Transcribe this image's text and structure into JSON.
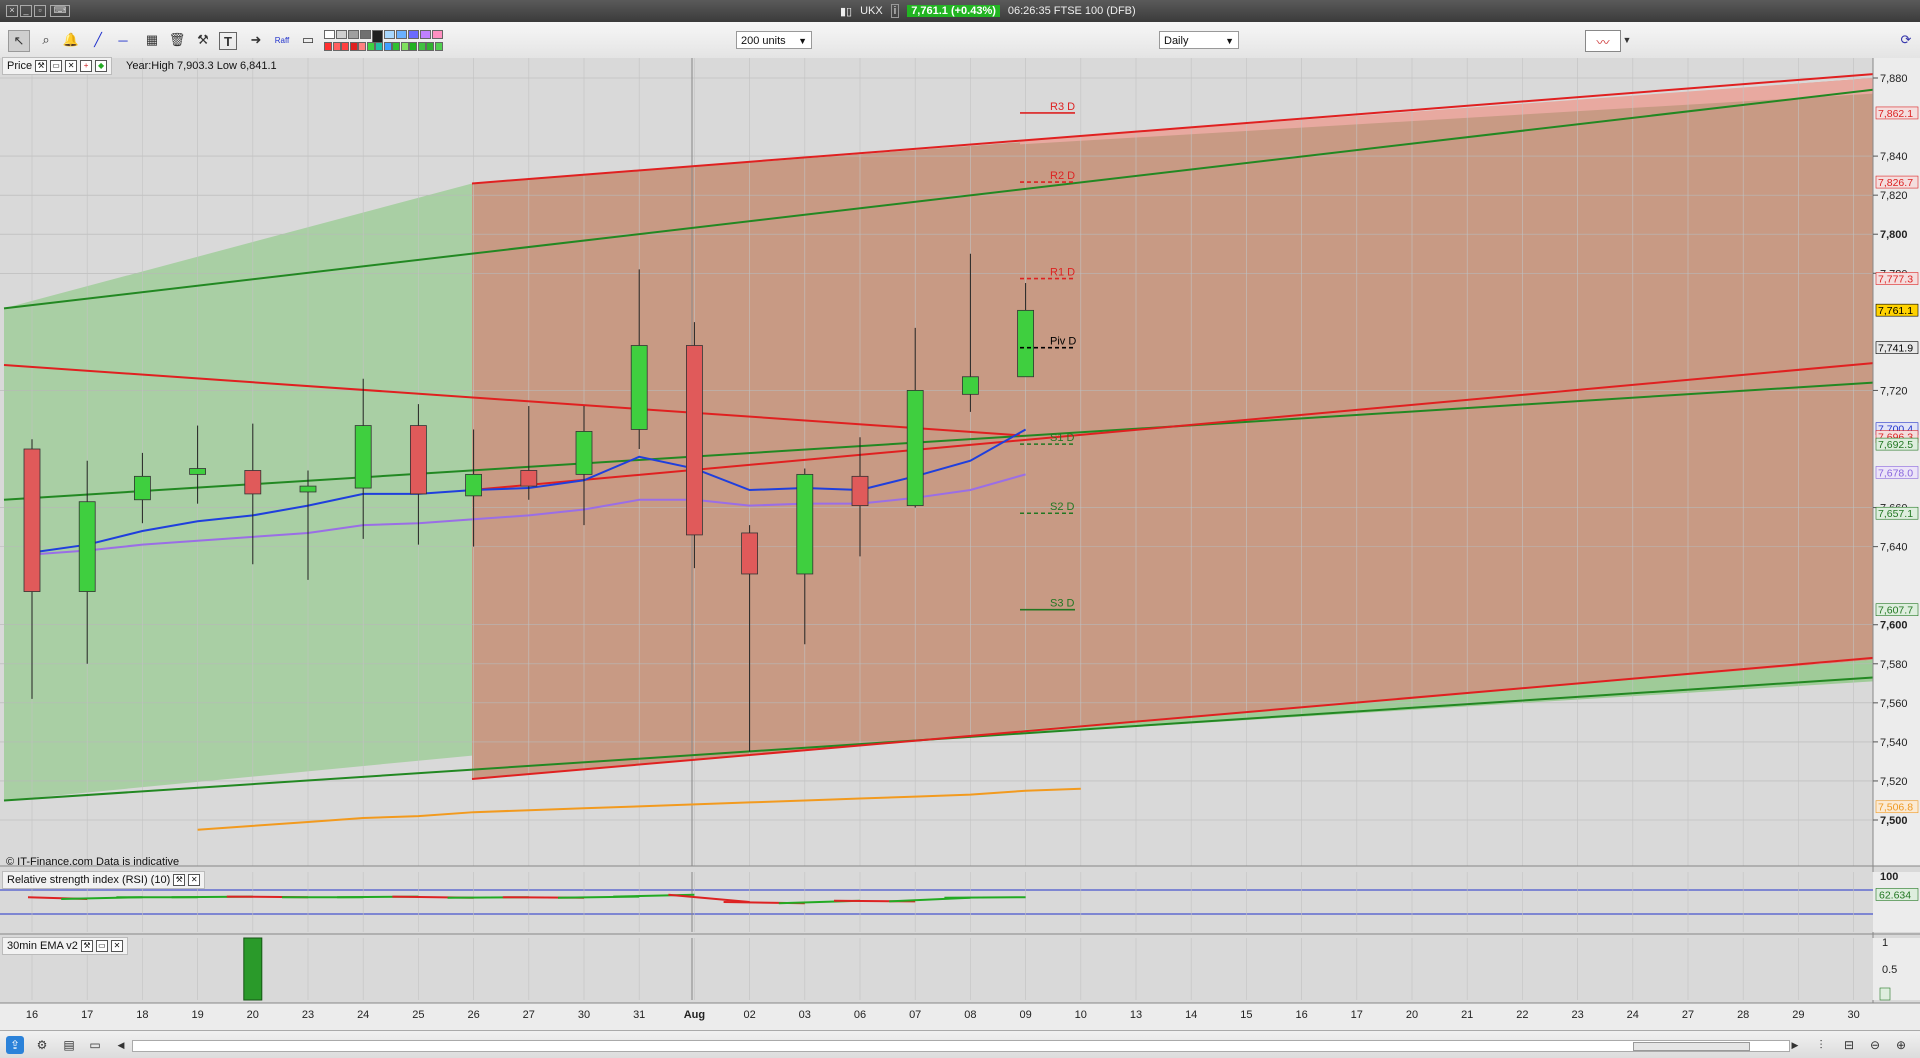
{
  "window": {
    "symbol": "UKX",
    "price_badge": "7,761.1 (+0.43%)",
    "time_title": "06:26:35 FTSE 100 (DFB)"
  },
  "toolbar": {
    "units": "200 units",
    "period": "Daily",
    "tool_label_raff": "Raff"
  },
  "price_panel": {
    "name": "Price",
    "year_range": "Year:High 7,903.3 Low 6,841.1",
    "copyright": "© IT-Finance.com  Data is indicative"
  },
  "rsi_panel": {
    "name": "Relative strength index (RSI) (10)"
  },
  "ema_panel": {
    "name": "30min EMA v2"
  },
  "colors": {
    "up": "#3fcf3f",
    "down": "#e05a5a",
    "green_zone": "#a9cfa4",
    "red_zone": "#c89a84",
    "price_tag": "#ffd200"
  },
  "chart_data": [
    {
      "type": "candlestick",
      "x": [
        "16",
        "17",
        "18",
        "19",
        "20",
        "23",
        "24",
        "25",
        "26",
        "27",
        "30",
        "31",
        "Aug",
        "02",
        "03",
        "06",
        "07",
        "08",
        "09",
        "10",
        "13",
        "14",
        "15",
        "16",
        "17",
        "20",
        "21",
        "22",
        "23",
        "24",
        "27",
        "28",
        "29",
        "30"
      ],
      "candles": [
        {
          "x": "16",
          "o": 7690,
          "h": 7695,
          "l": 7562,
          "c": 7617
        },
        {
          "x": "17",
          "o": 7617,
          "h": 7684,
          "l": 7580,
          "c": 7663
        },
        {
          "x": "18",
          "o": 7664,
          "h": 7688,
          "l": 7652,
          "c": 7676
        },
        {
          "x": "19",
          "o": 7677,
          "h": 7702,
          "l": 7662,
          "c": 7680
        },
        {
          "x": "20",
          "o": 7679,
          "h": 7703,
          "l": 7631,
          "c": 7667
        },
        {
          "x": "23",
          "o": 7668,
          "h": 7679,
          "l": 7623,
          "c": 7671
        },
        {
          "x": "24",
          "o": 7670,
          "h": 7726,
          "l": 7644,
          "c": 7702
        },
        {
          "x": "25",
          "o": 7702,
          "h": 7713,
          "l": 7641,
          "c": 7667
        },
        {
          "x": "26",
          "o": 7666,
          "h": 7700,
          "l": 7640,
          "c": 7677
        },
        {
          "x": "27",
          "o": 7679,
          "h": 7712,
          "l": 7664,
          "c": 7671
        },
        {
          "x": "30",
          "o": 7677,
          "h": 7712,
          "l": 7651,
          "c": 7699
        },
        {
          "x": "31",
          "o": 7700,
          "h": 7782,
          "l": 7690,
          "c": 7743
        },
        {
          "x": "Aug",
          "o": 7743,
          "h": 7755,
          "l": 7629,
          "c": 7646
        },
        {
          "x": "02",
          "o": 7647,
          "h": 7651,
          "l": 7535,
          "c": 7626
        },
        {
          "x": "03",
          "o": 7626,
          "h": 7680,
          "l": 7590,
          "c": 7677
        },
        {
          "x": "06",
          "o": 7676,
          "h": 7696,
          "l": 7635,
          "c": 7661
        },
        {
          "x": "07",
          "o": 7661,
          "h": 7752,
          "l": 7660,
          "c": 7720
        },
        {
          "x": "08",
          "o": 7718,
          "h": 7790,
          "l": 7709,
          "c": 7727
        },
        {
          "x": "09",
          "o": 7727,
          "h": 7775,
          "l": 7727,
          "c": 7761
        }
      ],
      "ma_blue": [
        7637,
        7641,
        7648,
        7653,
        7656,
        7661,
        7667,
        7667,
        7669,
        7670,
        7674,
        7686,
        7680,
        7669,
        7670,
        7669,
        7676,
        7684,
        7700
      ],
      "ma_purple": [
        7636,
        7638,
        7641,
        7643,
        7645,
        7647,
        7651,
        7652,
        7654,
        7656,
        7659,
        7664,
        7664,
        7661,
        7662,
        7662,
        7665,
        7669,
        7677
      ],
      "ma_orange": {
        "x_start": "19",
        "values": [
          7495,
          7497,
          7499,
          7501,
          7502,
          7504,
          7505,
          7506,
          7507,
          7508,
          7509,
          7510,
          7511,
          7512,
          7513,
          7515,
          7516
        ]
      },
      "pivots": [
        {
          "label": "R3 D",
          "value": 7862.1,
          "color": "#dd2222",
          "dash": false
        },
        {
          "label": "R2 D",
          "value": 7826.7,
          "color": "#dd2222",
          "dash": true
        },
        {
          "label": "R1 D",
          "value": 7777.3,
          "color": "#dd2222",
          "dash": true
        },
        {
          "label": "Piv D",
          "value": 7741.9,
          "color": "#000000",
          "dash": true
        },
        {
          "label": "S1 D",
          "value": 7692.5,
          "color": "#227722",
          "dash": true
        },
        {
          "label": "S2 D",
          "value": 7657.1,
          "color": "#227722",
          "dash": true
        },
        {
          "label": "S3 D",
          "value": 7607.7,
          "color": "#227722",
          "dash": false
        }
      ],
      "y_ticks": [
        "7,880",
        "7,840",
        "7,820",
        "7,800",
        "7,780",
        "7,720",
        "7,660",
        "7,640",
        "7,600",
        "7,580",
        "7,560",
        "7,540",
        "7,520",
        "7,500"
      ],
      "y_tick_values": [
        7880,
        7840,
        7820,
        7800,
        7780,
        7720,
        7660,
        7640,
        7600,
        7580,
        7560,
        7540,
        7520,
        7500
      ],
      "price_tags": [
        {
          "label": "7,862.1",
          "value": 7862.1,
          "color": "#dd2222",
          "bg": "#f4dede"
        },
        {
          "label": "7,826.7",
          "value": 7826.7,
          "color": "#dd2222",
          "bg": "#f4dede"
        },
        {
          "label": "7,777.3",
          "value": 7777.3,
          "color": "#dd2222",
          "bg": "#f4dede"
        },
        {
          "label": "7,761.1",
          "value": 7761.1,
          "color": "#000000",
          "bg": "#ffd200"
        },
        {
          "label": "7,741.9",
          "value": 7741.9,
          "color": "#000000",
          "bg": "#e8e8e8"
        },
        {
          "label": "7,700.4",
          "value": 7700.4,
          "color": "#2233cc",
          "bg": "#e2e4f6"
        },
        {
          "label": "7,696.3",
          "value": 7696.3,
          "color": "#dd2222",
          "bg": "#f4dede"
        },
        {
          "label": "7,692.5",
          "value": 7692.5,
          "color": "#227722",
          "bg": "#deeede"
        },
        {
          "label": "7,678.0",
          "value": 7678.0,
          "color": "#8866dd",
          "bg": "#ece4f8"
        },
        {
          "label": "7,657.1",
          "value": 7657.1,
          "color": "#227722",
          "bg": "#deeede"
        },
        {
          "label": "7,607.7",
          "value": 7607.7,
          "color": "#227722",
          "bg": "#deeede"
        },
        {
          "label": "7,506.8",
          "value": 7506.8,
          "color": "#ee9922",
          "bg": "#fbead4"
        }
      ]
    },
    {
      "type": "line",
      "name": "rsi",
      "y_tick": "100",
      "value_tag": "62.634",
      "levels": [
        70,
        30
      ],
      "values": [
        58,
        55,
        58,
        58,
        59,
        58,
        58,
        59,
        57,
        58,
        57,
        59,
        62,
        50,
        48,
        52,
        51,
        57,
        58,
        59,
        63
      ]
    },
    {
      "type": "bar",
      "name": "ema",
      "y_ticks": [
        "1",
        "0.5",
        "0"
      ],
      "bar_x": "20",
      "bar_value": 1
    }
  ]
}
